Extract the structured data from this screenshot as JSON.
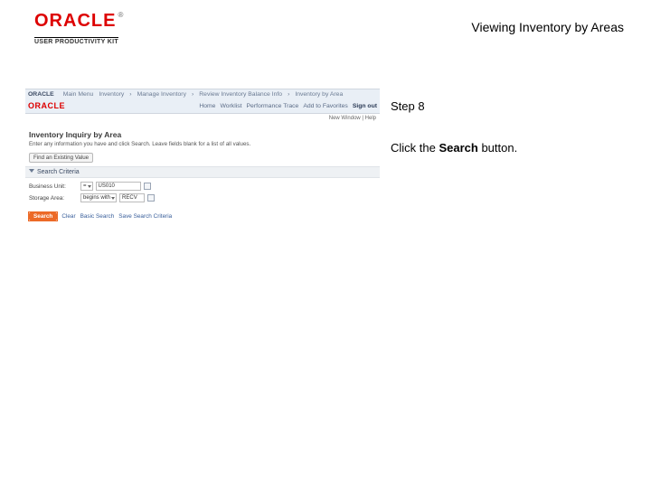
{
  "header": {
    "brand_name": "ORACLE",
    "brand_tm": "®",
    "brand_sub": "USER PRODUCTIVITY KIT",
    "doc_title": "Viewing Inventory by Areas"
  },
  "instruction": {
    "step_label": "Step 8",
    "line_pre": "Click the ",
    "line_bold": "Search",
    "line_post": " button."
  },
  "app": {
    "breadcrumb_lead": "ORACLE",
    "crumb1": "Main Menu",
    "crumb2": "Inventory",
    "crumb3": "Manage Inventory",
    "crumb4": "Review Inventory Balance Info",
    "crumb5": "Inventory by Area",
    "logo": "ORACLE",
    "tabs": [
      "Home",
      "Worklist",
      "Performance Trace",
      "Add to Favorites",
      "Sign out"
    ],
    "status": "New Window | Help",
    "page_title": "Inventory Inquiry by Area",
    "page_desc": "Enter any information you have and click Search. Leave fields blank for a list of all values.",
    "find_btn": "Find an Existing Value",
    "section": "Search Criteria",
    "fields": {
      "bu_label": "Business Unit:",
      "bu_op": "=",
      "bu_val": "US010",
      "sa_label": "Storage Area:",
      "sa_op": "begins with",
      "sa_val": "RECV"
    },
    "actions": {
      "search": "Search",
      "clear": "Clear",
      "basic": "Basic Search",
      "save": "Save Search Criteria"
    }
  }
}
